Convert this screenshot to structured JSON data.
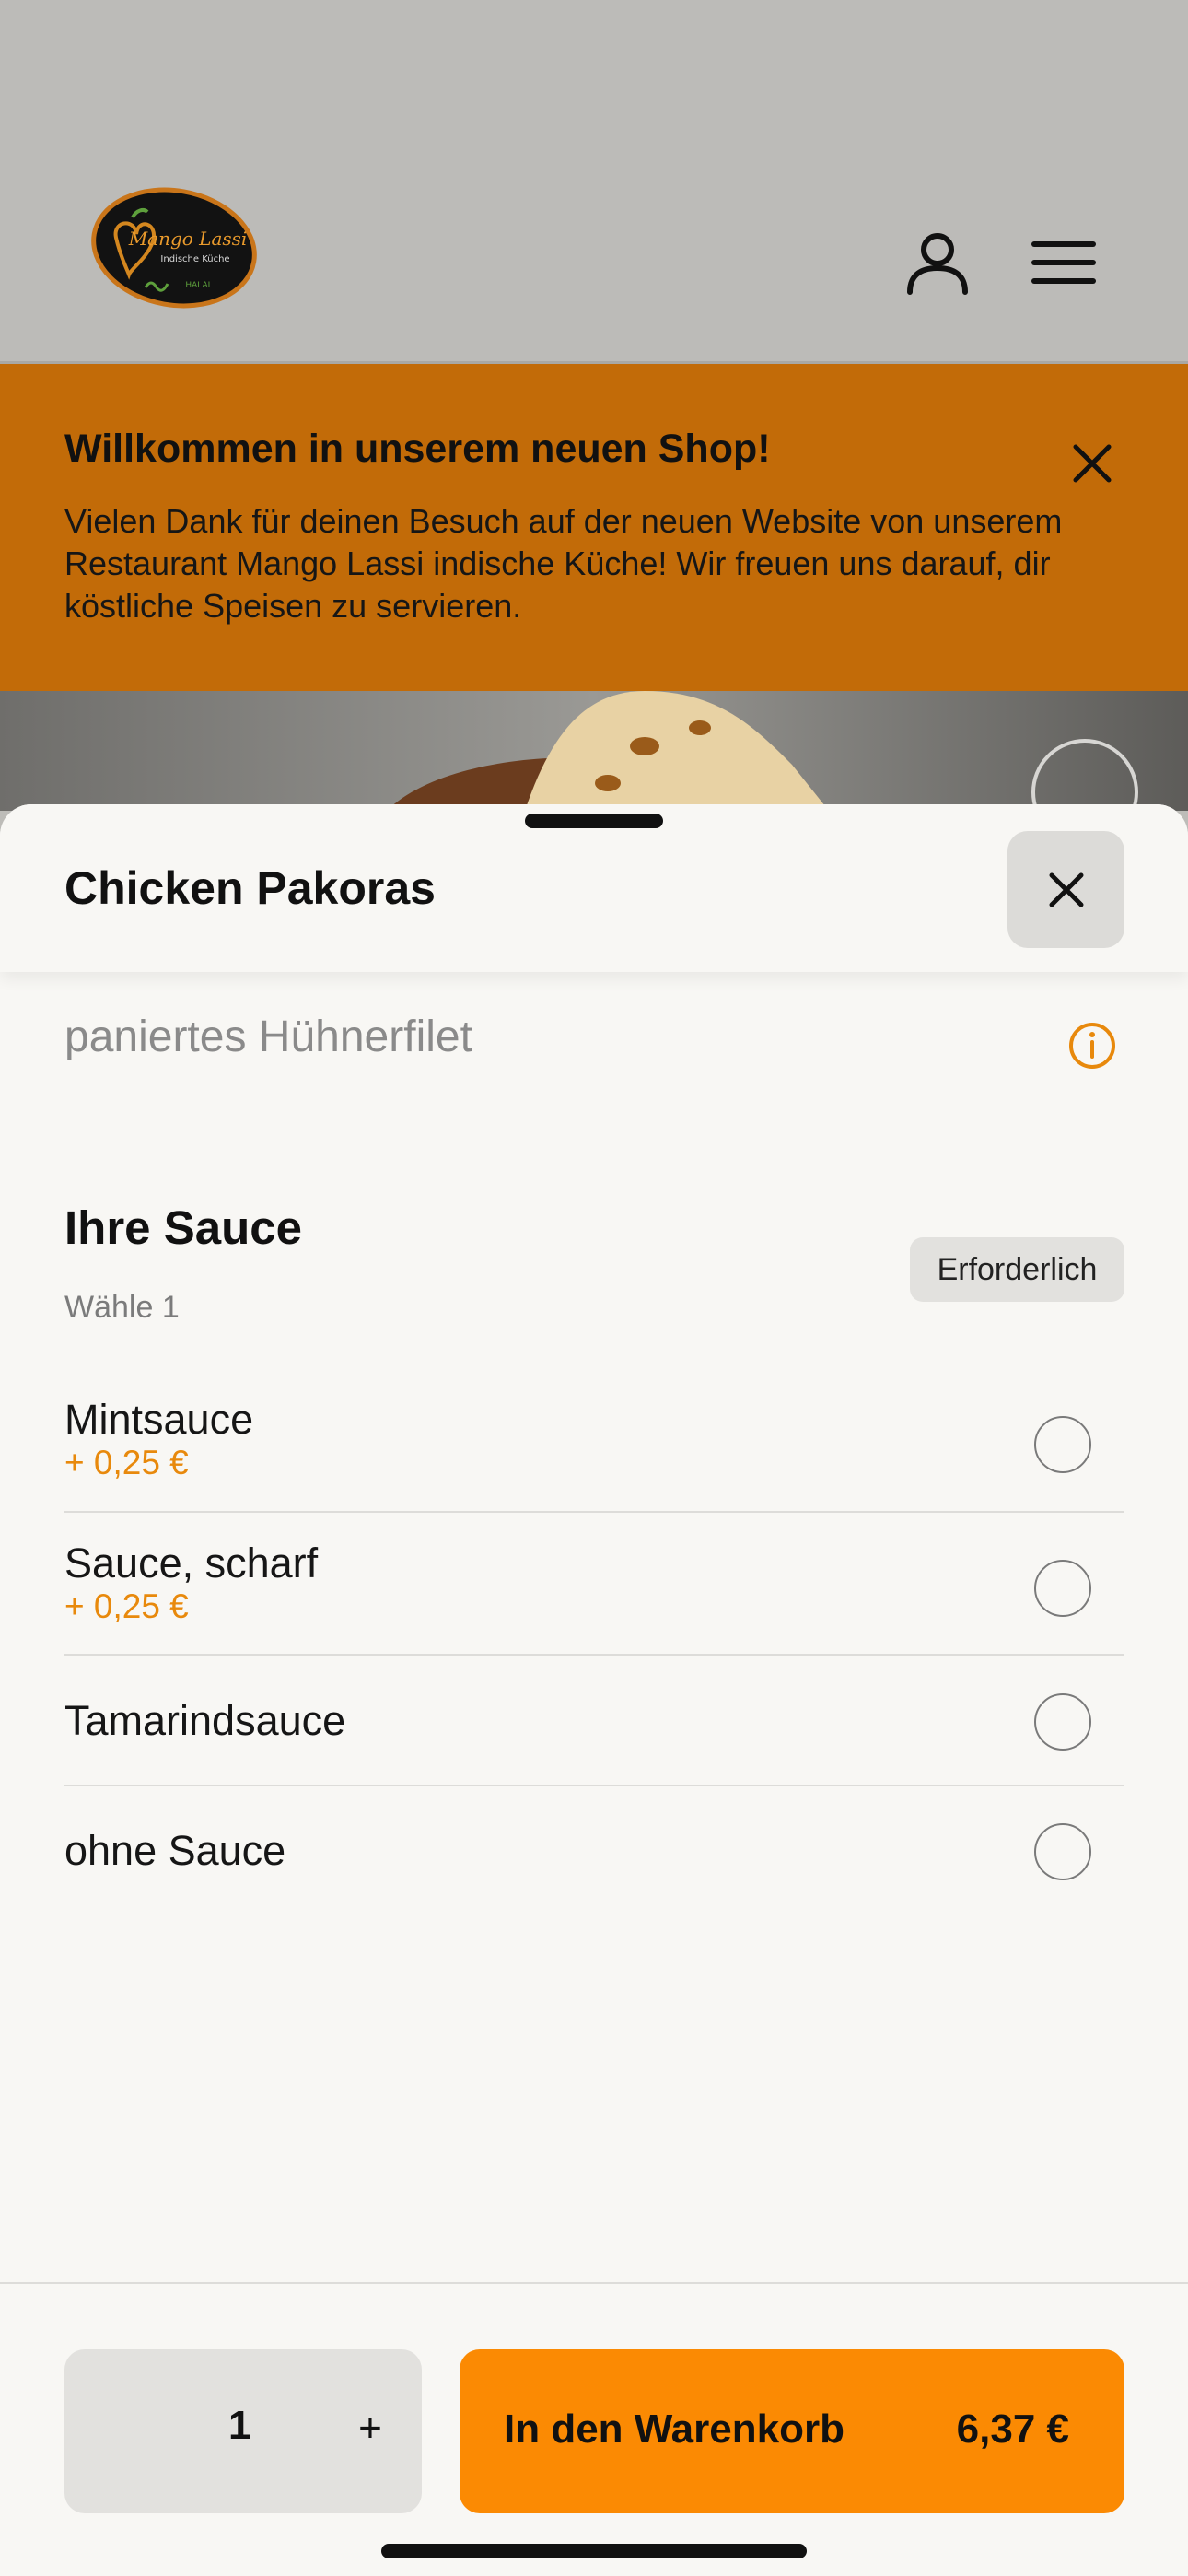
{
  "header": {
    "logo": {
      "name": "Mango Lassi",
      "tagline": "Indische Küche",
      "halal": "HALAL"
    },
    "icons": [
      "user-icon",
      "menu-icon"
    ]
  },
  "banner": {
    "title": "Willkommen in unserem neuen Shop!",
    "text": "Vielen Dank für deinen Besuch auf der neuen Website von unserem Restaurant Mango Lassi indische Küche! Wir freuen uns darauf, dir köstliche Speisen zu servieren."
  },
  "sheet": {
    "title": "Chicken Pakoras",
    "description": "paniertes Hühnerfilet",
    "section": {
      "title": "Ihre Sauce",
      "subtitle": "Wähle 1",
      "badge": "Erforderlich",
      "options": [
        {
          "label": "Mintsauce",
          "price": "+ 0,25 €",
          "selected": false
        },
        {
          "label": "Sauce, scharf",
          "price": "+ 0,25 €",
          "selected": false
        },
        {
          "label": "Tamarindsauce",
          "price": "",
          "selected": false
        },
        {
          "label": "ohne Sauce",
          "price": "",
          "selected": false
        }
      ]
    }
  },
  "footer": {
    "quantity": "1",
    "plus": "+",
    "cart_label": "In den Warenkorb",
    "cart_price": "6,37 €"
  },
  "colors": {
    "accent": "#fb8a03",
    "banner": "#c26b08",
    "price": "#e8890c"
  }
}
